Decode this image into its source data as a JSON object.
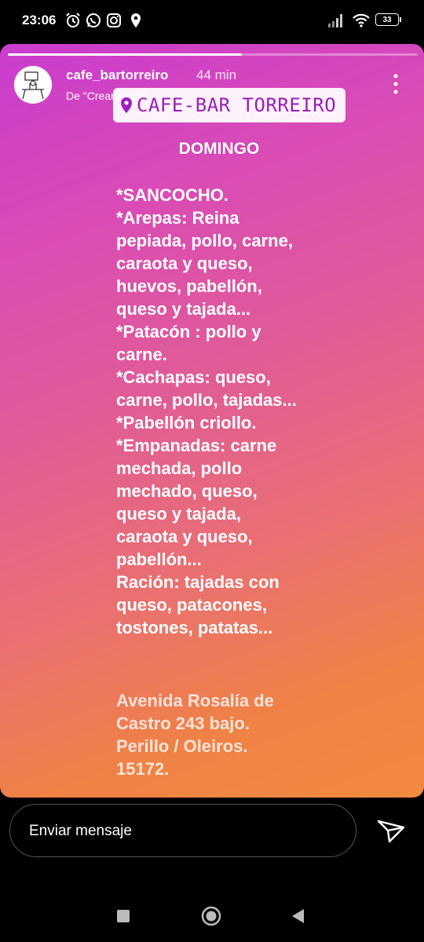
{
  "status_bar": {
    "time": "23:06",
    "battery": "33"
  },
  "story": {
    "progress": 0.57,
    "username": "cafe_bartorreiro",
    "time_ago": "44 min",
    "from_label": "De \"Crear modo\"",
    "location": "CAFE-BAR TORREIRO",
    "title": "DOMINGO",
    "menu_lines": [
      "*SANCOCHO.",
      "*Arepas: Reina",
      "pepiada, pollo, carne,",
      "caraota y queso,",
      "huevos, pabellón,",
      "queso y tajada...",
      "*Patacón : pollo y",
      "carne.",
      "*Cachapas: queso,",
      "carne, pollo, tajadas...",
      "*Pabellón criollo.",
      "*Empanadas: carne",
      "mechada, pollo",
      "mechado, queso,",
      "queso y tajada,",
      "caraota y queso,",
      "pabellón...",
      "Ración: tajadas con",
      "queso, patacones,",
      "tostones, patatas..."
    ],
    "address_lines": [
      "Avenida Rosalía de",
      "Castro 243 bajo.",
      "Perillo / Oleiros.",
      "15172."
    ]
  },
  "reply": {
    "placeholder": "Enviar mensaje"
  },
  "icons": {
    "alarm": "alarm-icon",
    "whatsapp": "whatsapp-icon",
    "instagram": "instagram-icon",
    "location": "location-pin-icon",
    "signal": "signal-icon",
    "wifi": "wifi-icon",
    "battery": "battery-icon",
    "more": "more-vertical-icon",
    "send": "send-icon",
    "recents": "recents-square-icon",
    "home": "home-circle-icon",
    "back": "back-triangle-icon"
  }
}
